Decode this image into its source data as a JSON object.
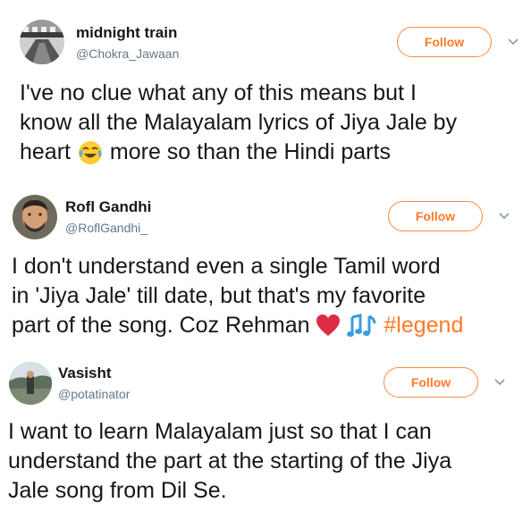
{
  "tweets": [
    {
      "name": "midnight train",
      "handle": "@Chokra_Jawaan",
      "follow_label": "Follow",
      "lines": [
        "I've no clue what any of this means but I",
        "know all the Malayalam lyrics of Jiya Jale by"
      ],
      "line3_a": "heart",
      "line3_b": "more so than the Hindi parts",
      "emoji": "face-with-tears-of-joy-icon"
    },
    {
      "name": "Rofl Gandhi",
      "handle": "@RoflGandhi_",
      "follow_label": "Follow",
      "lines": [
        "I don't understand even a single Tamil word",
        "in 'Jiya Jale' till date, but that's my favorite"
      ],
      "line3_a": "part of the song. Coz Rehman",
      "hashtag": "#legend",
      "emoji": [
        "red-heart-icon",
        "musical-notes-icon"
      ]
    },
    {
      "name": "Vasisht",
      "handle": "@potatinator",
      "follow_label": "Follow",
      "lines": [
        "I want to learn Malayalam just so that I can",
        "understand the part at the starting of the Jiya",
        "Jale song from Dil Se."
      ]
    }
  ],
  "colors": {
    "accent": "#ff7a2a",
    "handle": "#657786",
    "text": "#14171a"
  }
}
